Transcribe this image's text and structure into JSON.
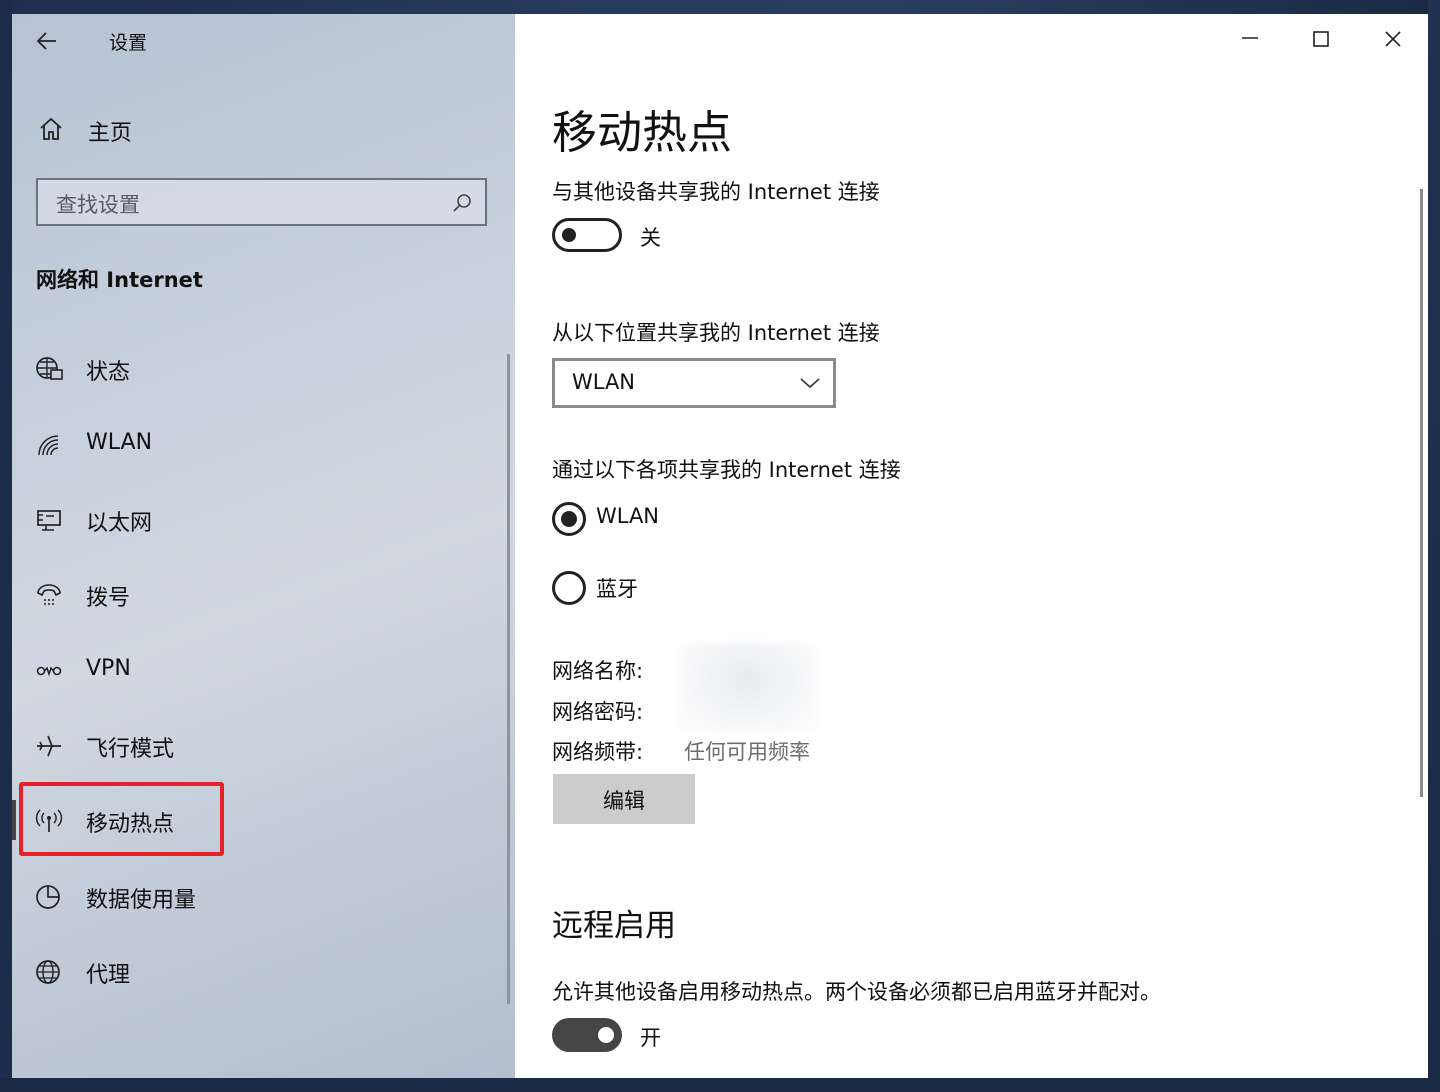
{
  "window": {
    "title": "设置"
  },
  "sidebar": {
    "home_label": "主页",
    "search_placeholder": "查找设置",
    "section_title": "网络和 Internet",
    "items": [
      {
        "label": "状态",
        "icon": "globe-network-icon"
      },
      {
        "label": "WLAN",
        "icon": "wifi-icon"
      },
      {
        "label": "以太网",
        "icon": "ethernet-icon"
      },
      {
        "label": "拨号",
        "icon": "dialup-icon"
      },
      {
        "label": "VPN",
        "icon": "vpn-icon"
      },
      {
        "label": "飞行模式",
        "icon": "airplane-icon"
      },
      {
        "label": "移动热点",
        "icon": "hotspot-icon",
        "selected": true
      },
      {
        "label": "数据使用量",
        "icon": "data-usage-icon"
      },
      {
        "label": "代理",
        "icon": "globe-icon"
      }
    ]
  },
  "main": {
    "title": "移动热点",
    "share_label": "与其他设备共享我的 Internet 连接",
    "share_toggle": {
      "state": "off",
      "text": "关"
    },
    "source_label": "从以下位置共享我的 Internet 连接",
    "source_value": "WLAN",
    "via_label": "通过以下各项共享我的 Internet 连接",
    "via_options": [
      {
        "label": "WLAN",
        "selected": true
      },
      {
        "label": "蓝牙",
        "selected": false
      }
    ],
    "network_name_key": "网络名称:",
    "network_password_key": "网络密码:",
    "network_band_key": "网络频带:",
    "network_band_value": "任何可用频率",
    "edit_button": "编辑",
    "remote_title": "远程启用",
    "remote_desc": "允许其他设备启用移动热点。两个设备必须都已启用蓝牙并配对。",
    "remote_toggle": {
      "state": "on",
      "text": "开"
    }
  },
  "colors": {
    "highlight": "#e5212b",
    "sidebar_bg": "#c5cfdc",
    "toggle_on": "#454545"
  }
}
